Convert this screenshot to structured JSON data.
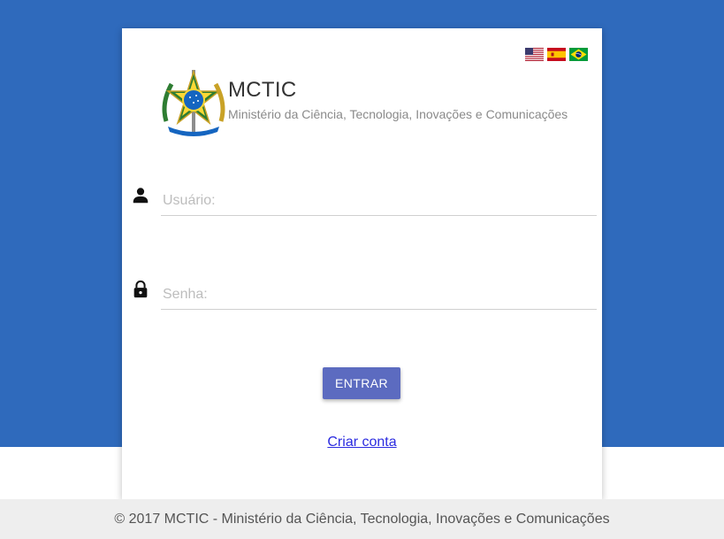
{
  "header": {
    "title": "MCTIC",
    "subtitle": "Ministério da Ciência, Tecnologia, Inovações e Comunicações"
  },
  "languages": [
    {
      "code": "en",
      "icon": "us-flag-icon"
    },
    {
      "code": "es",
      "icon": "spain-flag-icon"
    },
    {
      "code": "pt",
      "icon": "brazil-flag-icon"
    }
  ],
  "form": {
    "username": {
      "placeholder": "Usuário:",
      "value": "",
      "icon": "person-icon"
    },
    "password": {
      "placeholder": "Senha:",
      "value": "",
      "icon": "lock-icon"
    },
    "submit_label": "ENTRAR",
    "create_account_label": "Criar conta"
  },
  "footer": {
    "text": "© 2017 MCTIC - Ministério da Ciência, Tecnologia, Inovações e Comunicações"
  },
  "colors": {
    "background_blue": "#2f6abc",
    "button": "#5c6bc0",
    "link": "#2c2ce0",
    "footer_bg": "#eeeeee"
  }
}
